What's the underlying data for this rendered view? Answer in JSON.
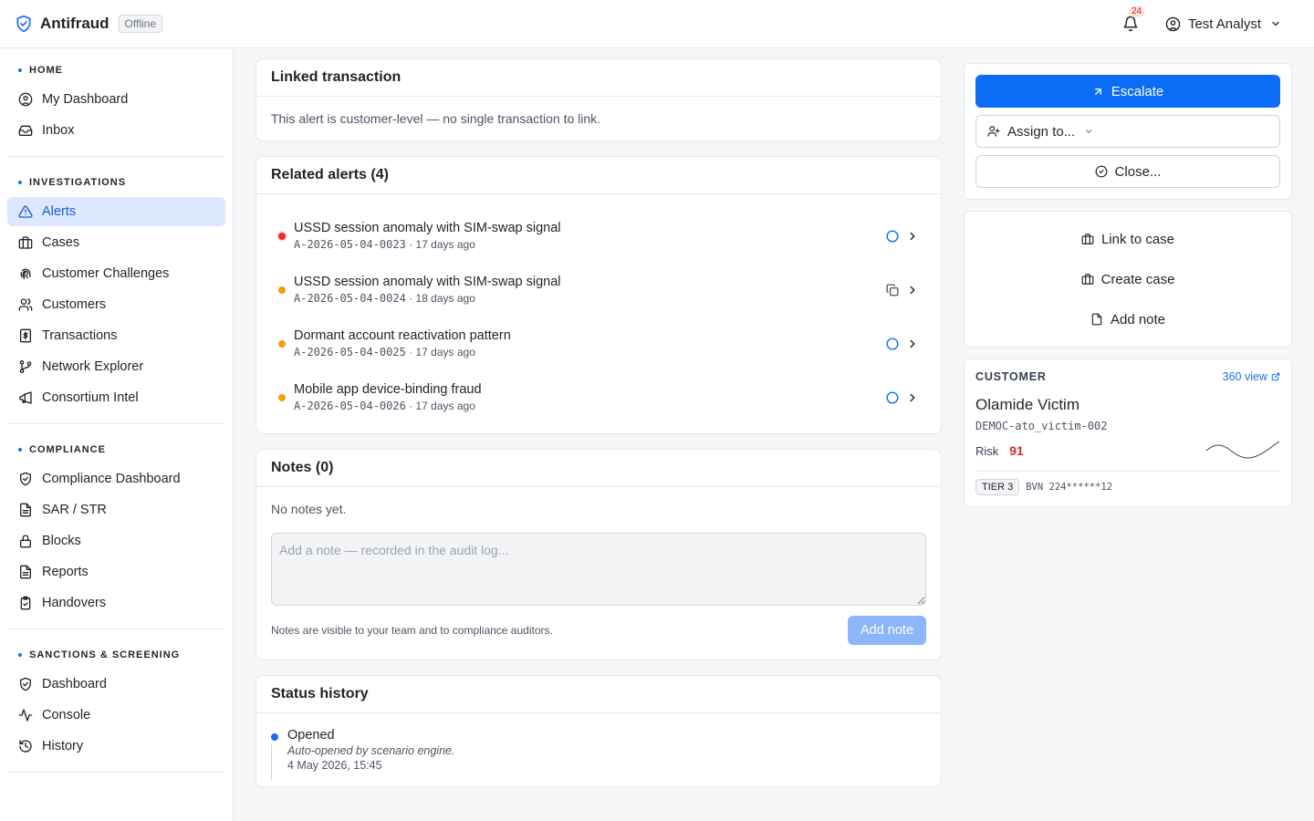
{
  "header": {
    "app_name": "Antifraud",
    "status_badge": "Offline",
    "notification_count": "24",
    "user_name": "Test Analyst"
  },
  "sidebar": {
    "sections": [
      {
        "title": "HOME",
        "items": [
          "My Dashboard",
          "Inbox"
        ]
      },
      {
        "title": "INVESTIGATIONS",
        "items": [
          "Alerts",
          "Cases",
          "Customer Challenges",
          "Customers",
          "Transactions",
          "Network Explorer",
          "Consortium Intel"
        ]
      },
      {
        "title": "COMPLIANCE",
        "items": [
          "Compliance Dashboard",
          "SAR / STR",
          "Blocks",
          "Reports",
          "Handovers"
        ]
      },
      {
        "title": "SANCTIONS & SCREENING",
        "items": [
          "Dashboard",
          "Console",
          "History"
        ]
      }
    ],
    "active_item": "Alerts"
  },
  "linked_transaction": {
    "title": "Linked transaction",
    "body": "This alert is customer-level — no single transaction to link."
  },
  "related_alerts": {
    "title": "Related alerts (4)",
    "items": [
      {
        "title": "USSD session anomaly with SIM-swap signal",
        "id": "A-2026-05-04-0023",
        "age": "17 days ago",
        "severity_color": "#ef2b2b"
      },
      {
        "title": "USSD session anomaly with SIM-swap signal",
        "id": "A-2026-05-04-0024",
        "age": "18 days ago",
        "severity_color": "#f59e0b"
      },
      {
        "title": "Dormant account reactivation pattern",
        "id": "A-2026-05-04-0025",
        "age": "17 days ago",
        "severity_color": "#f59e0b"
      },
      {
        "title": "Mobile app device-binding fraud",
        "id": "A-2026-05-04-0026",
        "age": "17 days ago",
        "severity_color": "#f59e0b"
      }
    ]
  },
  "notes": {
    "title": "Notes (0)",
    "empty": "No notes yet.",
    "placeholder": "Add a note — recorded in the audit log...",
    "hint": "Notes are visible to your team and to compliance auditors.",
    "add_label": "Add note"
  },
  "status_history": {
    "title": "Status history",
    "entries": [
      {
        "status": "Opened",
        "desc": "Auto-opened by scenario engine.",
        "time": "4 May 2026, 15:45"
      }
    ]
  },
  "actions": {
    "escalate": "Escalate",
    "assign": "Assign to...",
    "close": "Close...",
    "link_case": "Link to case",
    "create_case": "Create case",
    "add_note": "Add note"
  },
  "customer": {
    "label": "CUSTOMER",
    "view_link": "360 view",
    "name": "Olamide Victim",
    "id": "DEMOC-ato_victim-002",
    "risk_label": "Risk",
    "risk_value": "91",
    "tier": "TIER 3",
    "bvn": "BVN 224******12"
  },
  "colors": {
    "accent": "#0b6cf5",
    "active_nav_bg": "#dbe8fd",
    "risk": "#dc2626"
  }
}
